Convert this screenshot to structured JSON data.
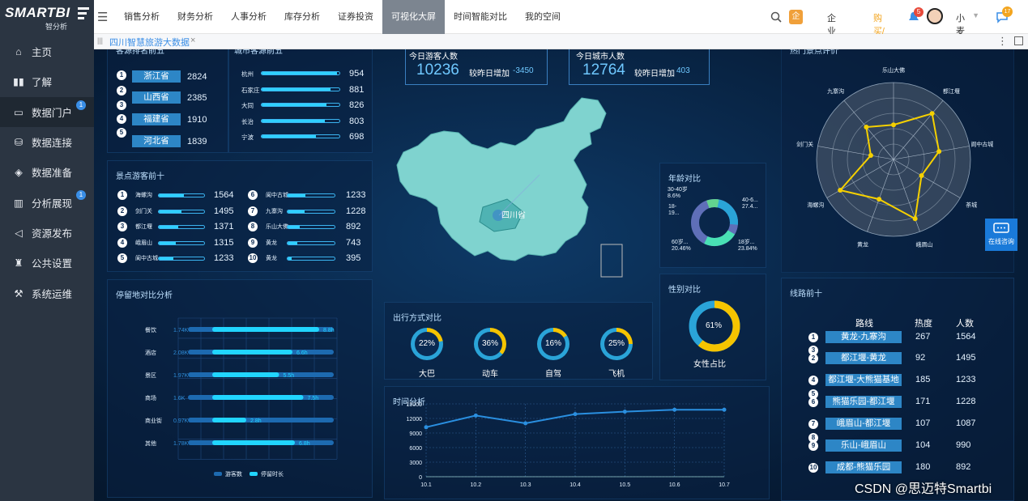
{
  "app": {
    "logo": "SMARTBI",
    "logo_sub": "智分析"
  },
  "topnav": [
    "销售分析",
    "财务分析",
    "人事分析",
    "库存分析",
    "证券投资",
    "可视化大屏",
    "时间智能对比",
    "我的空间"
  ],
  "topnav_active": 5,
  "topright": {
    "edition": "企业版",
    "upgrade": "购买/升级",
    "notify_count": "5",
    "user": "小麦",
    "msg_count": "17"
  },
  "sidebar": [
    {
      "label": "主页",
      "icon": "home-icon"
    },
    {
      "label": "了解",
      "icon": "book-icon"
    },
    {
      "label": "数据门户",
      "icon": "monitor-icon",
      "badge": "1",
      "active": true
    },
    {
      "label": "数据连接",
      "icon": "database-icon"
    },
    {
      "label": "数据准备",
      "icon": "cube-icon"
    },
    {
      "label": "分析展现",
      "icon": "bar-chart-icon",
      "badge": "1"
    },
    {
      "label": "资源发布",
      "icon": "send-icon"
    },
    {
      "label": "公共设置",
      "icon": "settings-icon"
    },
    {
      "label": "系统运维",
      "icon": "tools-icon"
    }
  ],
  "tab": {
    "label": "四川智慧旅游大数据",
    "close": "×"
  },
  "kpi": {
    "visitors": {
      "title": "今日游客人数",
      "value": "10236",
      "compare": "较昨日增加",
      "delta": "-3450"
    },
    "vehicles": {
      "title": "今日城市人数",
      "value": "12764",
      "compare": "较昨日增加",
      "delta": "403"
    }
  },
  "source_provinces": {
    "title": "客源排名前五",
    "items": [
      {
        "name": "浙江省",
        "value": "2824"
      },
      {
        "name": "山西省",
        "value": "2385"
      },
      {
        "name": "福建省",
        "value": "1910"
      },
      {
        "name": "河北省",
        "value": "1839"
      }
    ],
    "numbers": [
      "1",
      "2",
      "3",
      "4",
      "5"
    ]
  },
  "source_cities": {
    "title": "城市客源前五",
    "items": [
      {
        "name": "杭州",
        "value": "954",
        "pct": 0.97
      },
      {
        "name": "石家庄",
        "value": "881",
        "pct": 0.89
      },
      {
        "name": "大同",
        "value": "826",
        "pct": 0.83
      },
      {
        "name": "长治",
        "value": "803",
        "pct": 0.81
      },
      {
        "name": "宁波",
        "value": "698",
        "pct": 0.7
      }
    ]
  },
  "attractions": {
    "title": "景点游客前十",
    "items": [
      {
        "num": "1",
        "name": "海螺沟",
        "value": "1564",
        "pct": 0.55
      },
      {
        "num": "2",
        "name": "剑门关",
        "value": "1495",
        "pct": 0.5
      },
      {
        "num": "3",
        "name": "都江堰",
        "value": "1371",
        "pct": 0.42
      },
      {
        "num": "4",
        "name": "峨眉山",
        "value": "1315",
        "pct": 0.38
      },
      {
        "num": "5",
        "name": "阆中古城",
        "value": "1233",
        "pct": 0.33
      },
      {
        "num": "6",
        "name": "阆中古城",
        "value": "1233",
        "pct": 0.38
      },
      {
        "num": "7",
        "name": "九寨沟",
        "value": "1228",
        "pct": 0.36
      },
      {
        "num": "8",
        "name": "乐山大佛",
        "value": "892",
        "pct": 0.26
      },
      {
        "num": "9",
        "name": "黄龙",
        "value": "743",
        "pct": 0.2
      },
      {
        "num": "10",
        "name": "黄龙",
        "value": "395",
        "pct": 0.08
      }
    ]
  },
  "stay": {
    "title": "停留地对比分析",
    "rows": [
      {
        "cat": "餐饮",
        "visitors": "1.74K",
        "hours": "8.8h",
        "vp": 0.2,
        "hp": 0.88
      },
      {
        "cat": "酒店",
        "visitors": "2.08K",
        "hours": "6.6h",
        "vp": 0.2,
        "hp": 0.66
      },
      {
        "cat": "景区",
        "visitors": "1.97K",
        "hours": "5.5h",
        "vp": 0.2,
        "hp": 0.55
      },
      {
        "cat": "商场",
        "visitors": "1.6K",
        "hours": "7.5h",
        "vp": 0.17,
        "hp": 0.75
      },
      {
        "cat": "商业街",
        "visitors": "0.97K",
        "hours": "2.8h",
        "vp": 0.11,
        "hp": 0.28
      },
      {
        "cat": "其他",
        "visitors": "1.78K",
        "hours": "6.8h",
        "vp": 0.2,
        "hp": 0.68
      }
    ],
    "legend": [
      "游客数",
      "停留时长"
    ]
  },
  "transport": {
    "title": "出行方式对比",
    "items": [
      {
        "label": "大巴",
        "pct": "22%",
        "v": 0.22
      },
      {
        "label": "动车",
        "pct": "36%",
        "v": 0.36
      },
      {
        "label": "自驾",
        "pct": "16%",
        "v": 0.16
      },
      {
        "label": "飞机",
        "pct": "25%",
        "v": 0.25
      }
    ]
  },
  "age": {
    "title": "年龄对比",
    "labels": [
      "30-40岁\n8.6%",
      "40-6...\n27.4...",
      "18-\n19...",
      "60岁...\n20.46%",
      "18岁...\n23.84%"
    ]
  },
  "gender": {
    "title": "性别对比",
    "pct": "61%",
    "label": "女性占比",
    "v": 0.61
  },
  "map": {
    "label": "四川省"
  },
  "radar": {
    "title": "热门景点评价",
    "axes": [
      "乐山大佛",
      "都江堰",
      "阆中古城",
      "茶城",
      "峨眉山",
      "黄龙",
      "海螺沟",
      "剑门关",
      "九寨沟"
    ],
    "values": [
      0.45,
      0.78,
      0.6,
      0.42,
      0.82,
      0.55,
      0.8,
      0.3,
      0.55
    ]
  },
  "routes": {
    "title": "线路前十",
    "headers": [
      "路线",
      "热度",
      "人数"
    ],
    "rows": [
      {
        "num": "1",
        "route": "黄龙-九寨沟",
        "heat": "267",
        "people": "1564"
      },
      {
        "num": "2",
        "route": "都江堰-黄龙",
        "heat": "92",
        "people": "1495"
      },
      {
        "num": "4",
        "route": "都江堰-大熊猫基地",
        "heat": "185",
        "people": "1233"
      },
      {
        "num": "6",
        "route": "熊猫乐园-都江堰",
        "heat": "171",
        "people": "1228"
      },
      {
        "num": "7",
        "route": "峨眉山-都江堰",
        "heat": "107",
        "people": "1087"
      },
      {
        "num": "9",
        "route": "乐山-峨眉山",
        "heat": "104",
        "people": "990"
      },
      {
        "num": "10",
        "route": "成都-熊猫乐园",
        "heat": "180",
        "people": "892"
      }
    ],
    "extra_numbers": [
      "3",
      "5",
      "8"
    ]
  },
  "chart_data": {
    "type": "line",
    "title": "时间分析",
    "x": [
      "10.1",
      "10.2",
      "10.3",
      "10.4",
      "10.5",
      "10.6",
      "10.7"
    ],
    "series": [
      {
        "values": [
          10200,
          12600,
          11000,
          12900,
          13400,
          13800,
          13800
        ]
      }
    ],
    "yticks": [
      "15000",
      "12000",
      "9000",
      "6000",
      "3000",
      "0"
    ],
    "ylim": [
      0,
      15000
    ]
  },
  "consult": "在线咨询",
  "watermark": "CSDN @思迈特Smartbi"
}
